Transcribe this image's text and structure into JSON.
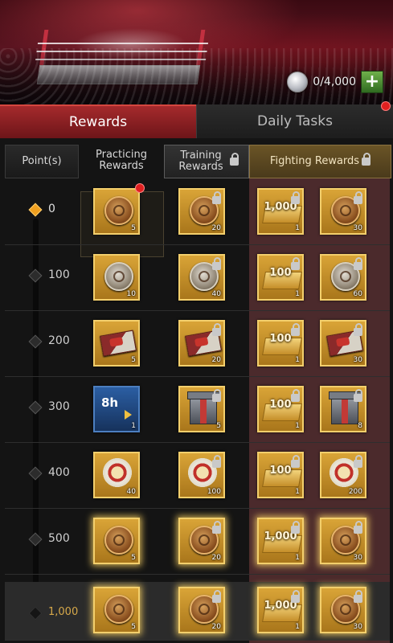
{
  "header": {
    "currency_display": "0/4,000",
    "currency_icon": "silver-coin-icon",
    "add_button_icon": "plus-icon"
  },
  "tabs": [
    {
      "label": "Rewards",
      "active": true
    },
    {
      "label": "Daily Tasks",
      "active": false
    }
  ],
  "columns": {
    "points": "Point(s)",
    "practicing": "Practicing Rewards",
    "training": "Training Rewards",
    "fighting": "Fighting Rewards"
  },
  "rows": [
    {
      "point": "0",
      "items": [
        {
          "icon": "gold-medal",
          "qty": "5"
        },
        {
          "icon": "gold-medal",
          "qty": "20",
          "locked": true
        },
        {
          "icon": "gold-bar",
          "label": "1,000",
          "qty": "1",
          "locked": true
        },
        {
          "icon": "gold-medal",
          "qty": "30",
          "locked": true
        }
      ]
    },
    {
      "point": "100",
      "items": [
        {
          "icon": "silver-medal",
          "qty": "10"
        },
        {
          "icon": "silver-medal",
          "qty": "40",
          "locked": true
        },
        {
          "icon": "gold-bar",
          "label": "100",
          "qty": "1",
          "locked": true
        },
        {
          "icon": "silver-medal",
          "qty": "60",
          "locked": true
        }
      ]
    },
    {
      "point": "200",
      "items": [
        {
          "icon": "ticket",
          "qty": "5"
        },
        {
          "icon": "ticket",
          "qty": "20",
          "locked": true
        },
        {
          "icon": "gold-bar",
          "label": "100",
          "qty": "1",
          "locked": true
        },
        {
          "icon": "ticket",
          "qty": "30",
          "locked": true
        }
      ]
    },
    {
      "point": "300",
      "items": [
        {
          "icon": "timer",
          "label": "8h",
          "qty": "1"
        },
        {
          "icon": "supply-box",
          "qty": "5",
          "locked": true
        },
        {
          "icon": "gold-bar",
          "label": "100",
          "qty": "1",
          "locked": true
        },
        {
          "icon": "supply-box",
          "qty": "8",
          "locked": true
        }
      ]
    },
    {
      "point": "400",
      "items": [
        {
          "icon": "badge",
          "qty": "40"
        },
        {
          "icon": "badge",
          "qty": "100",
          "locked": true
        },
        {
          "icon": "gold-bar",
          "label": "100",
          "qty": "1",
          "locked": true
        },
        {
          "icon": "badge",
          "qty": "200",
          "locked": true
        }
      ]
    },
    {
      "point": "500",
      "items": [
        {
          "icon": "gold-medal",
          "qty": "5"
        },
        {
          "icon": "gold-medal",
          "qty": "20",
          "locked": true
        },
        {
          "icon": "gold-bar",
          "label": "1,000",
          "qty": "1",
          "locked": true
        },
        {
          "icon": "gold-medal",
          "qty": "30",
          "locked": true
        }
      ]
    },
    {
      "point": "1,000",
      "items": [
        {
          "icon": "gold-medal",
          "qty": "5"
        },
        {
          "icon": "gold-medal",
          "qty": "20",
          "locked": true
        },
        {
          "icon": "gold-bar",
          "label": "1,000",
          "qty": "1",
          "locked": true
        },
        {
          "icon": "gold-medal",
          "qty": "30",
          "locked": true
        }
      ]
    }
  ],
  "colors": {
    "active_tab": "#a52a2c",
    "fighting_column": "#4b2a2c",
    "slot_gold": "#d9a437",
    "current_point_marker": "#f0a020"
  }
}
